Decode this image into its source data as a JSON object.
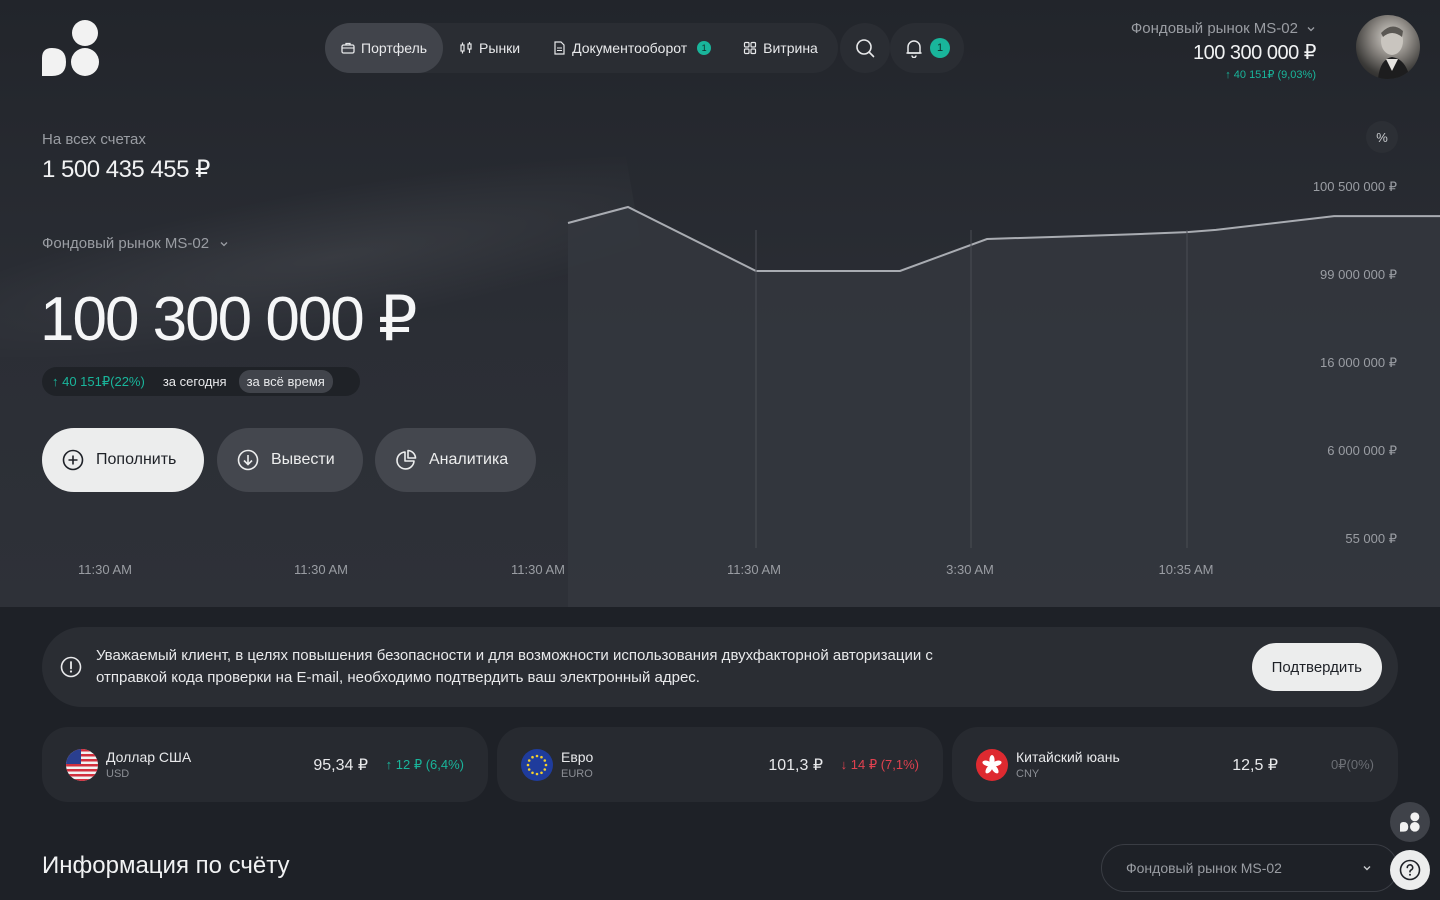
{
  "nav": {
    "items": [
      {
        "label": "Портфель",
        "active": true
      },
      {
        "label": "Рынки"
      },
      {
        "label": "Документооборот",
        "badge": "1"
      },
      {
        "label": "Витрина"
      }
    ],
    "notifications_badge": "1"
  },
  "account_top": {
    "name": "Фондовый рынок MS-02",
    "value": "100 300 000 ₽",
    "change": "↑ 40 151₽ (9,03%)"
  },
  "summary": {
    "all_accounts_label": "На всех счетах",
    "all_accounts_value": "1 500 435 455 ₽",
    "market_label": "Фондовый рынок MS-02",
    "balance": "100 300 000 ₽",
    "change": "↑ 40 151₽(22%)",
    "period_today": "за сегодня",
    "period_all": "за всё время",
    "percent_toggle": "%"
  },
  "actions": {
    "deposit": "Пополнить",
    "withdraw": "Вывести",
    "analytics": "Аналитика"
  },
  "chart_data": {
    "type": "area",
    "x": [
      "11:30 AM",
      "11:30 AM",
      "11:30 AM",
      "11:30 AM",
      "3:30 AM",
      "10:35 AM"
    ],
    "y_ticks": [
      "100 500 000 ₽",
      "99 000 000 ₽",
      "16 000 000 ₽",
      "6 000 000 ₽",
      "55 000 ₽"
    ],
    "series": [
      {
        "values": [
          0.93,
          1.0,
          0.72,
          0.72,
          0.72,
          0.86,
          0.87,
          0.88,
          0.89,
          0.9,
          0.96,
          0.96
        ]
      }
    ],
    "colors": {
      "line": "#a9acb2",
      "fill": "#34373e"
    },
    "grid": true
  },
  "alert": {
    "text": "Уважаемый клиент, в целях повышения безопасности и для возможности использования двухфакторной авторизации с отправкой кода проверки на E-mail, необходимо подтвердить ваш электронный адрес.",
    "button": "Подтвердить"
  },
  "currencies": [
    {
      "name": "Доллар США",
      "code": "USD",
      "rate": "95,34 ₽",
      "change": "↑ 12 ₽ (6,4%)",
      "trend": "up",
      "flag": "us-flag-icon"
    },
    {
      "name": "Евро",
      "code": "EURO",
      "rate": "101,3 ₽",
      "change": "↓ 14 ₽ (7,1%)",
      "trend": "down",
      "flag": "eu-flag-icon"
    },
    {
      "name": "Китайский юань",
      "code": "CNY",
      "rate": "12,5 ₽",
      "change": "0₽(0%)",
      "trend": "flat",
      "flag": "hk-flag-icon"
    }
  ],
  "info": {
    "title": "Информация по счёту",
    "account_select": "Фондовый рынок MS-02"
  },
  "colors": {
    "accent_green": "#19b59b",
    "accent_red": "#e0414f",
    "bg": "#1e2127"
  }
}
